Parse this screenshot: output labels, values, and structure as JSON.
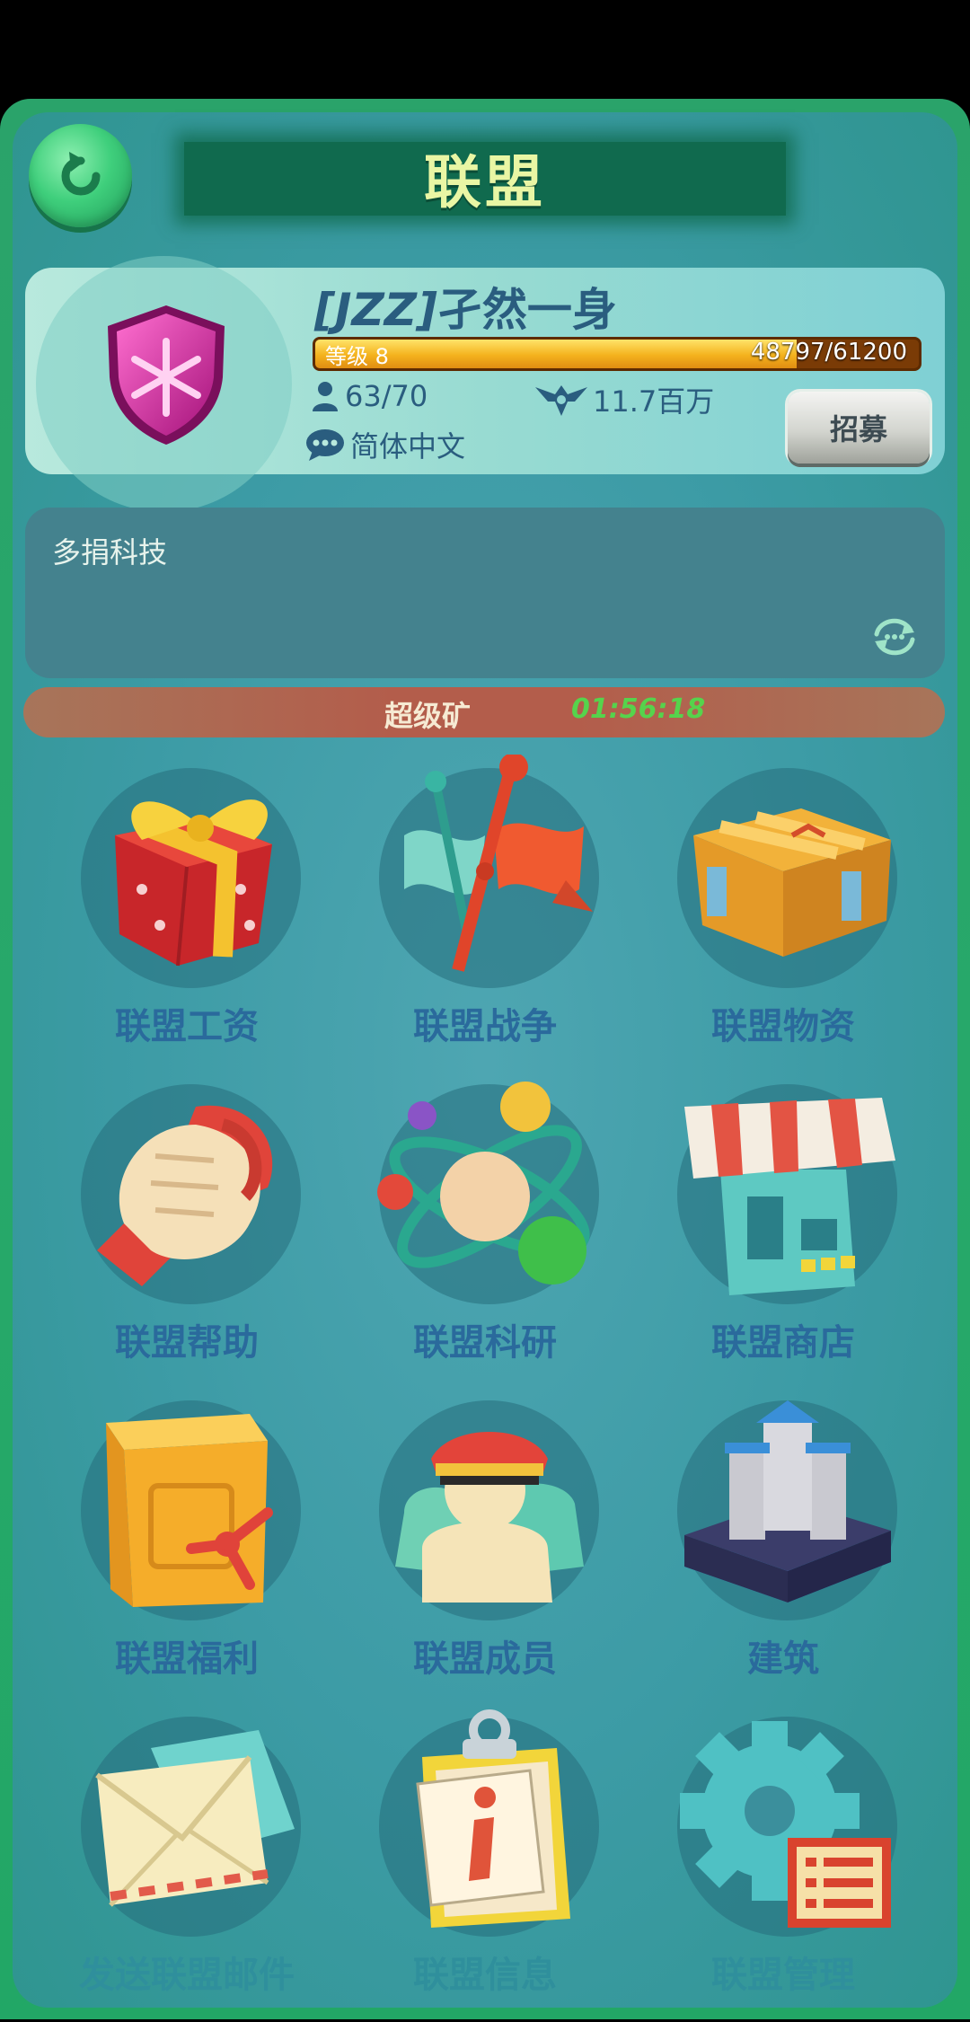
{
  "header": {
    "title": "联盟"
  },
  "alliance": {
    "tag": "[JZZ]",
    "name": "孑然一身",
    "level_label": "等级 8",
    "xp_text": "48797/61200",
    "xp_fraction": 0.797,
    "members": "63/70",
    "power": "11.7百万",
    "language": "简体中文",
    "recruit_label": "招募"
  },
  "announcement": {
    "text": "多捐科技"
  },
  "event": {
    "label": "超级矿",
    "timer": "01:56:18"
  },
  "menu": [
    {
      "label": "联盟工资",
      "icon": "gift-icon"
    },
    {
      "label": "联盟战争",
      "icon": "flag-icon"
    },
    {
      "label": "联盟物资",
      "icon": "crate-icon"
    },
    {
      "label": "联盟帮助",
      "icon": "handshake-icon"
    },
    {
      "label": "联盟科研",
      "icon": "atom-icon"
    },
    {
      "label": "联盟商店",
      "icon": "shop-icon"
    },
    {
      "label": "联盟福利",
      "icon": "safe-icon"
    },
    {
      "label": "联盟成员",
      "icon": "members-icon"
    },
    {
      "label": "建筑",
      "icon": "castle-icon"
    },
    {
      "label": "发送联盟邮件",
      "icon": "mail-icon"
    },
    {
      "label": "联盟信息",
      "icon": "info-clipboard-icon"
    },
    {
      "label": "联盟管理",
      "icon": "gear-icon"
    }
  ]
}
